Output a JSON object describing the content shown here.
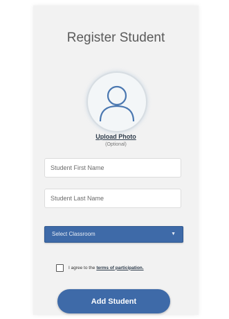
{
  "page": {
    "title": "Register Student"
  },
  "photo": {
    "icon": "user-silhouette-icon",
    "upload_label": "Upload Photo",
    "optional_label": "(Optional)"
  },
  "form": {
    "first_name": {
      "value": "",
      "placeholder": "Student First Name"
    },
    "last_name": {
      "value": "",
      "placeholder": "Student Last Name"
    },
    "classroom_select": {
      "selected": "Select Classroom",
      "chevron_icon": "chevron-down-icon"
    },
    "agree": {
      "checked": false,
      "text": "I agree to the",
      "link": "terms of participation."
    },
    "submit_label": "Add Student"
  },
  "colors": {
    "accent": "#3e6aa8",
    "card_background": "#f2f2f2",
    "title_text": "#5a5a5a"
  }
}
